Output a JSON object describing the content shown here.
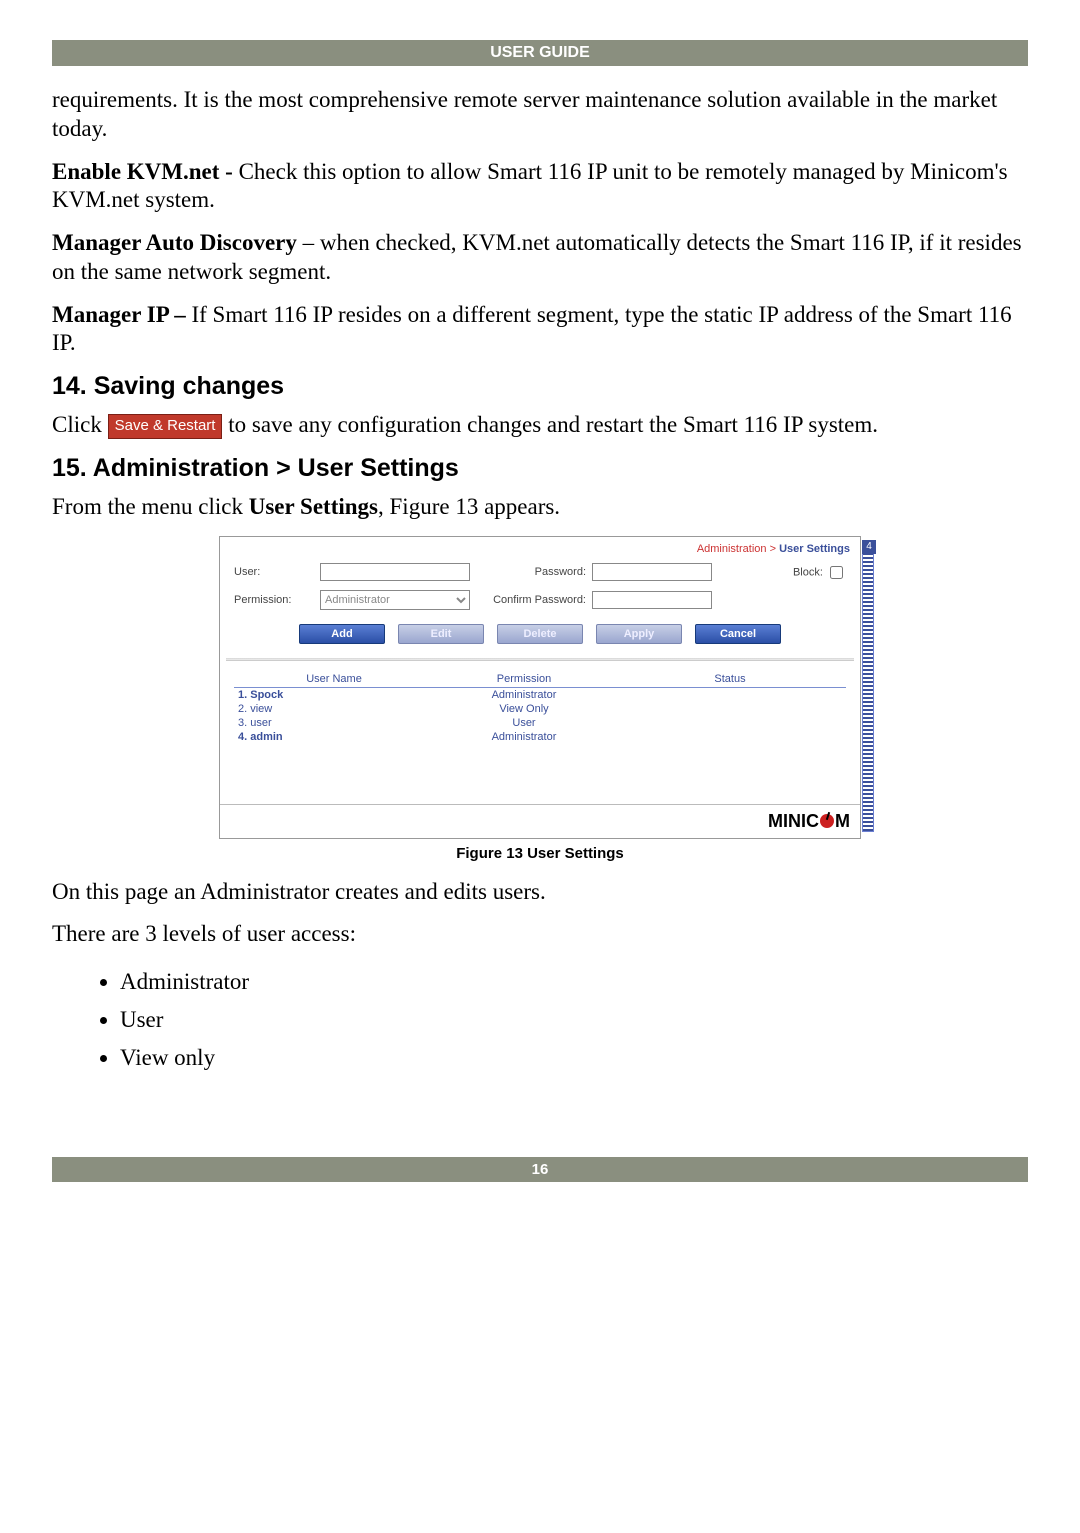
{
  "header": {
    "title": "USER GUIDE"
  },
  "para": {
    "p1": "requirements. It is the most comprehensive remote server maintenance solution available in the market today.",
    "p2_lead": "Enable KVM.net - ",
    "p2": "Check this option to allow Smart 116 IP unit to be remotely managed by Minicom's KVM.net system.",
    "p3_lead": "Manager Auto Discovery",
    "p3": " – when checked, KVM.net automatically detects the Smart 116 IP, if it resides on the same network segment.",
    "p4_lead": "Manager IP – ",
    "p4": "If Smart 116 IP resides on a different segment, type the static IP address of the Smart 116 IP."
  },
  "sec14": {
    "heading": "14. Saving changes",
    "pre": "Click ",
    "btn": "Save & Restart",
    "post": " to save any configuration changes and restart the Smart 116 IP system."
  },
  "sec15": {
    "heading": "15. Administration > User Settings",
    "intro": "From the menu click ",
    "intro_bold": "User Settings",
    "intro_post": ", Figure 13 appears."
  },
  "panel": {
    "crumbs": {
      "root": "Administration",
      "sep": ">",
      "cur": "User Settings"
    },
    "labels": {
      "user": "User:",
      "permission": "Permission:",
      "password": "Password:",
      "confirm": "Confirm Password:",
      "block": "Block:"
    },
    "permission_value": "Administrator",
    "buttons": {
      "add": "Add",
      "edit": "Edit",
      "delete": "Delete",
      "apply": "Apply",
      "cancel": "Cancel"
    },
    "table": {
      "headers": {
        "c1": "User Name",
        "c2": "Permission",
        "c3": "Status"
      },
      "rows": [
        {
          "n": "1.",
          "name": "Spock",
          "perm": "Administrator",
          "bold": true
        },
        {
          "n": "2.",
          "name": "view",
          "perm": "View Only",
          "bold": false
        },
        {
          "n": "3.",
          "name": "user",
          "perm": "User",
          "bold": false
        },
        {
          "n": "4.",
          "name": "admin",
          "perm": "Administrator",
          "bold": true
        }
      ]
    },
    "footer_brand_pre": "MINIC",
    "footer_brand_post": "M",
    "deco_num": "4"
  },
  "fig_caption": "Figure 13 User Settings",
  "post": {
    "p1": "On this page an Administrator creates and edits users.",
    "p2": "There are 3 levels of user access:",
    "items": [
      "Administrator",
      "User",
      "View only"
    ]
  },
  "page_number": "16"
}
